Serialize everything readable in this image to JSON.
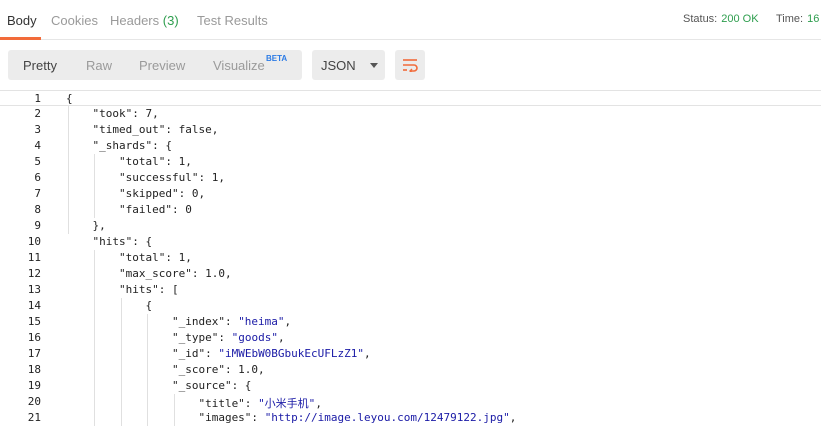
{
  "tabs": {
    "body": "Body",
    "cookies": "Cookies",
    "headers": "Headers",
    "headers_count": "(3)",
    "test_results": "Test Results"
  },
  "status": {
    "status_label": "Status:",
    "status_value": "200 OK",
    "time_label": "Time:",
    "time_value": "16"
  },
  "toolbar": {
    "pretty": "Pretty",
    "raw": "Raw",
    "preview": "Preview",
    "visualize": "Visualize",
    "beta": "BETA",
    "format": "JSON",
    "wrap_icon": "wrap-lines-icon"
  },
  "colors": {
    "accent": "#f26b3a",
    "status_ok": "#2e9e4e",
    "string": "#1a1aa6"
  },
  "code": [
    {
      "n": "1",
      "parts": [
        [
          "p",
          "{"
        ]
      ]
    },
    {
      "n": "2",
      "parts": [
        [
          "p",
          "    \"took\": 7,"
        ]
      ]
    },
    {
      "n": "3",
      "parts": [
        [
          "p",
          "    \"timed_out\": false,"
        ]
      ]
    },
    {
      "n": "4",
      "parts": [
        [
          "p",
          "    \"_shards\": {"
        ]
      ]
    },
    {
      "n": "5",
      "parts": [
        [
          "p",
          "        \"total\": 1,"
        ]
      ]
    },
    {
      "n": "6",
      "parts": [
        [
          "p",
          "        \"successful\": 1,"
        ]
      ]
    },
    {
      "n": "7",
      "parts": [
        [
          "p",
          "        \"skipped\": 0,"
        ]
      ]
    },
    {
      "n": "8",
      "parts": [
        [
          "p",
          "        \"failed\": 0"
        ]
      ]
    },
    {
      "n": "9",
      "parts": [
        [
          "p",
          "    },"
        ]
      ]
    },
    {
      "n": "10",
      "parts": [
        [
          "p",
          "    \"hits\": {"
        ]
      ]
    },
    {
      "n": "11",
      "parts": [
        [
          "p",
          "        \"total\": 1,"
        ]
      ]
    },
    {
      "n": "12",
      "parts": [
        [
          "p",
          "        \"max_score\": 1.0,"
        ]
      ]
    },
    {
      "n": "13",
      "parts": [
        [
          "p",
          "        \"hits\": ["
        ]
      ]
    },
    {
      "n": "14",
      "parts": [
        [
          "p",
          "            {"
        ]
      ]
    },
    {
      "n": "15",
      "parts": [
        [
          "p",
          "                \"_index\": "
        ],
        [
          "s",
          "\"heima\""
        ],
        [
          "p",
          ","
        ]
      ]
    },
    {
      "n": "16",
      "parts": [
        [
          "p",
          "                \"_type\": "
        ],
        [
          "s",
          "\"goods\""
        ],
        [
          "p",
          ","
        ]
      ]
    },
    {
      "n": "17",
      "parts": [
        [
          "p",
          "                \"_id\": "
        ],
        [
          "s",
          "\"iMWEbW0BGbukEcUFLzZ1\""
        ],
        [
          "p",
          ","
        ]
      ]
    },
    {
      "n": "18",
      "parts": [
        [
          "p",
          "                \"_score\": 1.0,"
        ]
      ]
    },
    {
      "n": "19",
      "parts": [
        [
          "p",
          "                \"_source\": {"
        ]
      ]
    },
    {
      "n": "20",
      "parts": [
        [
          "p",
          "                    \"title\": "
        ],
        [
          "s",
          "\"小米手机\""
        ],
        [
          "p",
          ","
        ]
      ]
    },
    {
      "n": "21",
      "parts": [
        [
          "p",
          "                    \"images\": "
        ],
        [
          "s",
          "\"http://image.leyou.com/12479122.jpg\""
        ],
        [
          "p",
          ","
        ]
      ]
    }
  ]
}
